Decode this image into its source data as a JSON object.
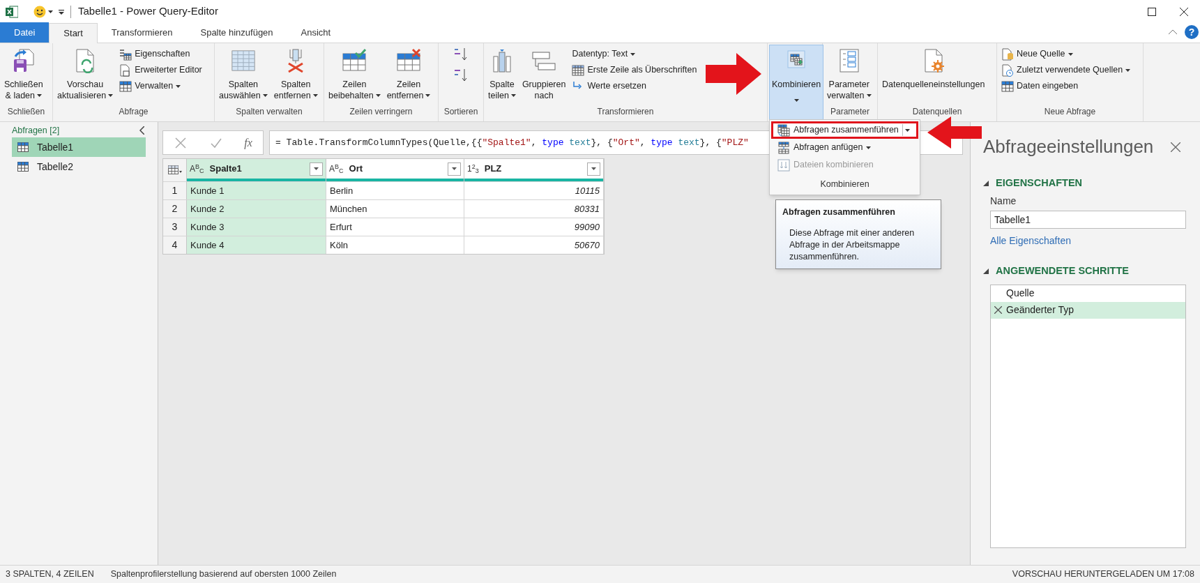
{
  "window": {
    "title": "Tabelle1 - Power Query-Editor",
    "help": "?"
  },
  "tabs": [
    {
      "label": "Datei",
      "kind": "file",
      "selected": false
    },
    {
      "label": "Start",
      "kind": "tab",
      "selected": true
    },
    {
      "label": "Transformieren",
      "kind": "tab",
      "selected": false
    },
    {
      "label": "Spalte hinzufügen",
      "kind": "tab",
      "selected": false
    },
    {
      "label": "Ansicht",
      "kind": "tab",
      "selected": false
    }
  ],
  "ribbon": {
    "groups": [
      {
        "label": "Schließen",
        "items": [
          {
            "kind": "large",
            "lines": [
              "Schließen",
              "& laden"
            ],
            "dropdown": true,
            "pressed": false
          }
        ]
      },
      {
        "label": "Abfrage",
        "items": [
          {
            "kind": "large",
            "lines": [
              "Vorschau",
              "aktualisieren"
            ],
            "dropdown": true,
            "pressed": false
          },
          {
            "kind": "small",
            "label": "Eigenschaften",
            "dropdown": false,
            "pressed": false
          },
          {
            "kind": "small",
            "label": "Erweiterter Editor",
            "dropdown": false,
            "pressed": false
          },
          {
            "kind": "small",
            "label": "Verwalten",
            "dropdown": true,
            "pressed": false
          }
        ]
      },
      {
        "label": "Spalten verwalten",
        "items": [
          {
            "kind": "large",
            "lines": [
              "Spalten",
              "auswählen"
            ],
            "dropdown": true,
            "pressed": false
          },
          {
            "kind": "large",
            "lines": [
              "Spalten",
              "entfernen"
            ],
            "dropdown": true,
            "pressed": false
          }
        ]
      },
      {
        "label": "Zeilen verringern",
        "items": [
          {
            "kind": "large",
            "lines": [
              "Zeilen",
              "beibehalten"
            ],
            "dropdown": true,
            "pressed": false
          },
          {
            "kind": "large",
            "lines": [
              "Zeilen",
              "entfernen"
            ],
            "dropdown": true,
            "pressed": false
          }
        ]
      },
      {
        "label": "Sortieren",
        "items": [
          {
            "kind": "icon",
            "pressed": false
          },
          {
            "kind": "icon",
            "pressed": false
          }
        ]
      },
      {
        "label": "Transformieren",
        "items": [
          {
            "kind": "large",
            "lines": [
              "Spalte",
              "teilen"
            ],
            "dropdown": true,
            "pressed": false
          },
          {
            "kind": "large",
            "lines": [
              "Gruppieren",
              "nach"
            ],
            "dropdown": false,
            "pressed": false
          },
          {
            "kind": "small",
            "label": "Datentyp: Text",
            "dropdown": true,
            "pressed": false
          },
          {
            "kind": "small",
            "label": "Erste Zeile als Überschriften",
            "dropdown": false,
            "pressed": false
          },
          {
            "kind": "small",
            "label": "Werte ersetzen",
            "dropdown": false,
            "pressed": false
          }
        ]
      },
      {
        "items": [
          {
            "kind": "large",
            "lines": [
              "Kombinieren"
            ],
            "dropdown": true,
            "pressed": true
          }
        ]
      },
      {
        "label": "Parameter",
        "items": [
          {
            "kind": "large",
            "lines": [
              "Parameter",
              "verwalten"
            ],
            "dropdown": true,
            "pressed": false
          }
        ]
      },
      {
        "label": "Datenquellen",
        "items": [
          {
            "kind": "large",
            "lines": [
              "Datenquelleneinstellungen"
            ],
            "dropdown": false,
            "pressed": false
          }
        ]
      },
      {
        "label": "Neue Abfrage",
        "items": [
          {
            "kind": "small",
            "label": "Neue Quelle",
            "dropdown": true,
            "pressed": false
          },
          {
            "kind": "small",
            "label": "Zuletzt verwendete Quellen",
            "dropdown": true,
            "pressed": false
          },
          {
            "kind": "small",
            "label": "Daten eingeben",
            "dropdown": false,
            "pressed": false
          }
        ]
      }
    ]
  },
  "queries": {
    "header": "Abfragen [2]",
    "items": [
      {
        "label": "Tabelle1",
        "selected": true
      },
      {
        "label": "Tabelle2",
        "selected": false
      }
    ]
  },
  "formula": {
    "fx": "fx",
    "tokens": [
      {
        "text": "= Table.TransformColumnTypes(Quelle,{{",
        "kind": "plain"
      },
      {
        "text": "\"Spalte1\"",
        "kind": "string"
      },
      {
        "text": ", ",
        "kind": "plain"
      },
      {
        "text": "type",
        "kind": "keyword"
      },
      {
        "text": " text",
        "kind": "type"
      },
      {
        "text": "}, {",
        "kind": "plain"
      },
      {
        "text": "\"Ort\"",
        "kind": "string"
      },
      {
        "text": ", ",
        "kind": "plain"
      },
      {
        "text": "type",
        "kind": "keyword"
      },
      {
        "text": " text",
        "kind": "type"
      },
      {
        "text": "}, {",
        "kind": "plain"
      },
      {
        "text": "\"PLZ\"",
        "kind": "string"
      }
    ]
  },
  "table": {
    "columns": [
      {
        "type_label": "A$^{B}$$_{C}$",
        "name": "Spalte1",
        "kind": "text",
        "selected": true
      },
      {
        "type_label": "A$^{B}$$_{C}$",
        "name": "Ort",
        "kind": "text",
        "selected": false
      },
      {
        "type_label": "1$^{2}$$_{3}$",
        "name": "PLZ",
        "kind": "number",
        "selected": false
      }
    ],
    "rows": [
      {
        "number": "1",
        "cells": [
          "Kunde 1",
          "Berlin",
          "10115"
        ]
      },
      {
        "number": "2",
        "cells": [
          "Kunde 2",
          "München",
          "80331"
        ]
      },
      {
        "number": "3",
        "cells": [
          "Kunde 3",
          "Erfurt",
          "99090"
        ]
      },
      {
        "number": "4",
        "cells": [
          "Kunde 4",
          "Köln",
          "50670"
        ]
      }
    ]
  },
  "combine_menu": {
    "items": [
      {
        "label": "Abfragen zusammenführen",
        "dropdown": true,
        "highlighted": true,
        "disabled": false
      },
      {
        "label": "Abfragen anfügen",
        "dropdown": true,
        "highlighted": false,
        "disabled": false
      },
      {
        "label": "Dateien kombinieren",
        "dropdown": false,
        "highlighted": false,
        "disabled": true
      }
    ],
    "footer": "Kombinieren"
  },
  "tooltip": {
    "title": "Abfragen zusammenführen",
    "text": "Diese Abfrage mit einer anderen Abfrage in der Arbeitsmappe zusammenführen."
  },
  "query_settings": {
    "title": "Abfrageeinstellungen",
    "properties_heading": "EIGENSCHAFTEN",
    "name_label": "Name",
    "name_value": "Tabelle1",
    "link": "Alle Eigenschaften",
    "steps_heading": "ANGEWENDETE SCHRITTE",
    "steps": [
      {
        "label": "Quelle",
        "selected": false
      },
      {
        "label": "Geänderter Typ",
        "selected": true
      }
    ]
  },
  "status_bar": {
    "columns_rows": "3 SPALTEN, 4 ZEILEN",
    "profiling": "Spaltenprofilerstellung basierend auf obersten 1000 Zeilen",
    "download": "VORSCHAU HERUNTERGELADEN UM 17:08"
  }
}
